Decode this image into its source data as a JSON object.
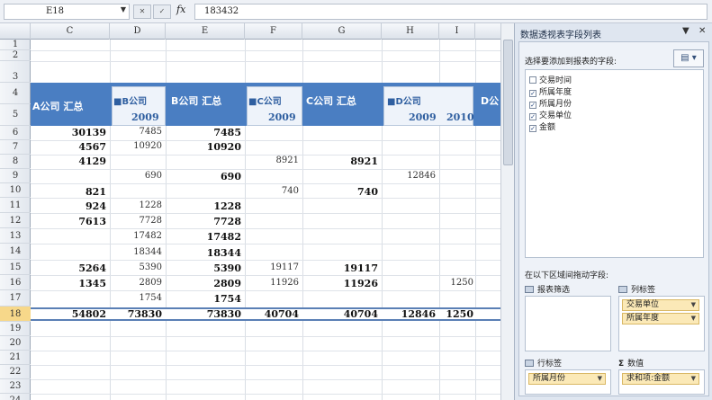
{
  "formula_bar": {
    "cell_ref": "E18",
    "fx_label": "fx",
    "value": "183432"
  },
  "columns": [
    "C",
    "D",
    "E",
    "F",
    "G",
    "H",
    "I"
  ],
  "rows": [
    "1",
    "2",
    "3",
    "4",
    "5",
    "6",
    "7",
    "8",
    "9",
    "10",
    "11",
    "12",
    "13",
    "14",
    "15",
    "16",
    "17",
    "18",
    "19",
    "20",
    "21",
    "22",
    "23",
    "24",
    "25"
  ],
  "selected_row": "18",
  "pivot": {
    "headers": {
      "c": "A公司 汇总",
      "d": "■B公司",
      "e": "B公司 汇总",
      "f": "■C公司",
      "g": "C公司 汇总",
      "h": "■D公司",
      "overflow": "D公"
    },
    "years": {
      "d": "2009",
      "f": "2009",
      "h1": "2009",
      "h2": "2010"
    },
    "values": {
      "r6": {
        "c": "30139",
        "d": "7485",
        "e": "7485"
      },
      "r7": {
        "c": "4567",
        "d": "10920",
        "e": "10920"
      },
      "r8": {
        "c": "4129",
        "f": "8921",
        "g": "8921"
      },
      "r9": {
        "d": "690",
        "e": "690",
        "h": "12846"
      },
      "r10": {
        "c": "821",
        "f": "740",
        "g": "740"
      },
      "r11": {
        "c": "924",
        "d": "1228",
        "e": "1228"
      },
      "r12": {
        "c": "7613",
        "d": "7728",
        "e": "7728"
      },
      "r13": {
        "d": "17482",
        "e": "17482"
      },
      "r14": {
        "d": "18344",
        "e": "18344"
      },
      "r15": {
        "c": "5264",
        "d": "5390",
        "e": "5390",
        "f": "19117",
        "g": "19117"
      },
      "r16": {
        "c": "1345",
        "d": "2809",
        "e": "2809",
        "f": "11926",
        "g": "11926",
        "i": "1250"
      },
      "r17": {
        "d": "1754",
        "e": "1754"
      },
      "r18": {
        "c": "54802",
        "d": "73830",
        "e": "73830",
        "f": "40704",
        "g": "40704",
        "h": "12846",
        "i": "1250"
      }
    }
  },
  "field_panel": {
    "title": "数据透视表字段列表",
    "dropdown_icon": "dropdown-arrow",
    "close_icon": "close",
    "prompt": "选择要添加到报表的字段:",
    "layout_icon": "layout-icon",
    "fields": [
      {
        "label": "交易时间",
        "checked": false
      },
      {
        "label": "所属年度",
        "checked": true
      },
      {
        "label": "所属月份",
        "checked": true
      },
      {
        "label": "交易单位",
        "checked": true
      },
      {
        "label": "金额",
        "checked": true
      }
    ],
    "drag_note": "在以下区域间拖动字段:",
    "areas": {
      "filter": {
        "label": "报表筛选"
      },
      "columns": {
        "label": "列标签",
        "items": [
          "交易单位",
          "所属年度"
        ]
      },
      "rows": {
        "label": "行标签",
        "items": [
          "所属月份"
        ]
      },
      "values": {
        "label": "数值",
        "items": [
          "求和项:金额"
        ]
      }
    }
  }
}
